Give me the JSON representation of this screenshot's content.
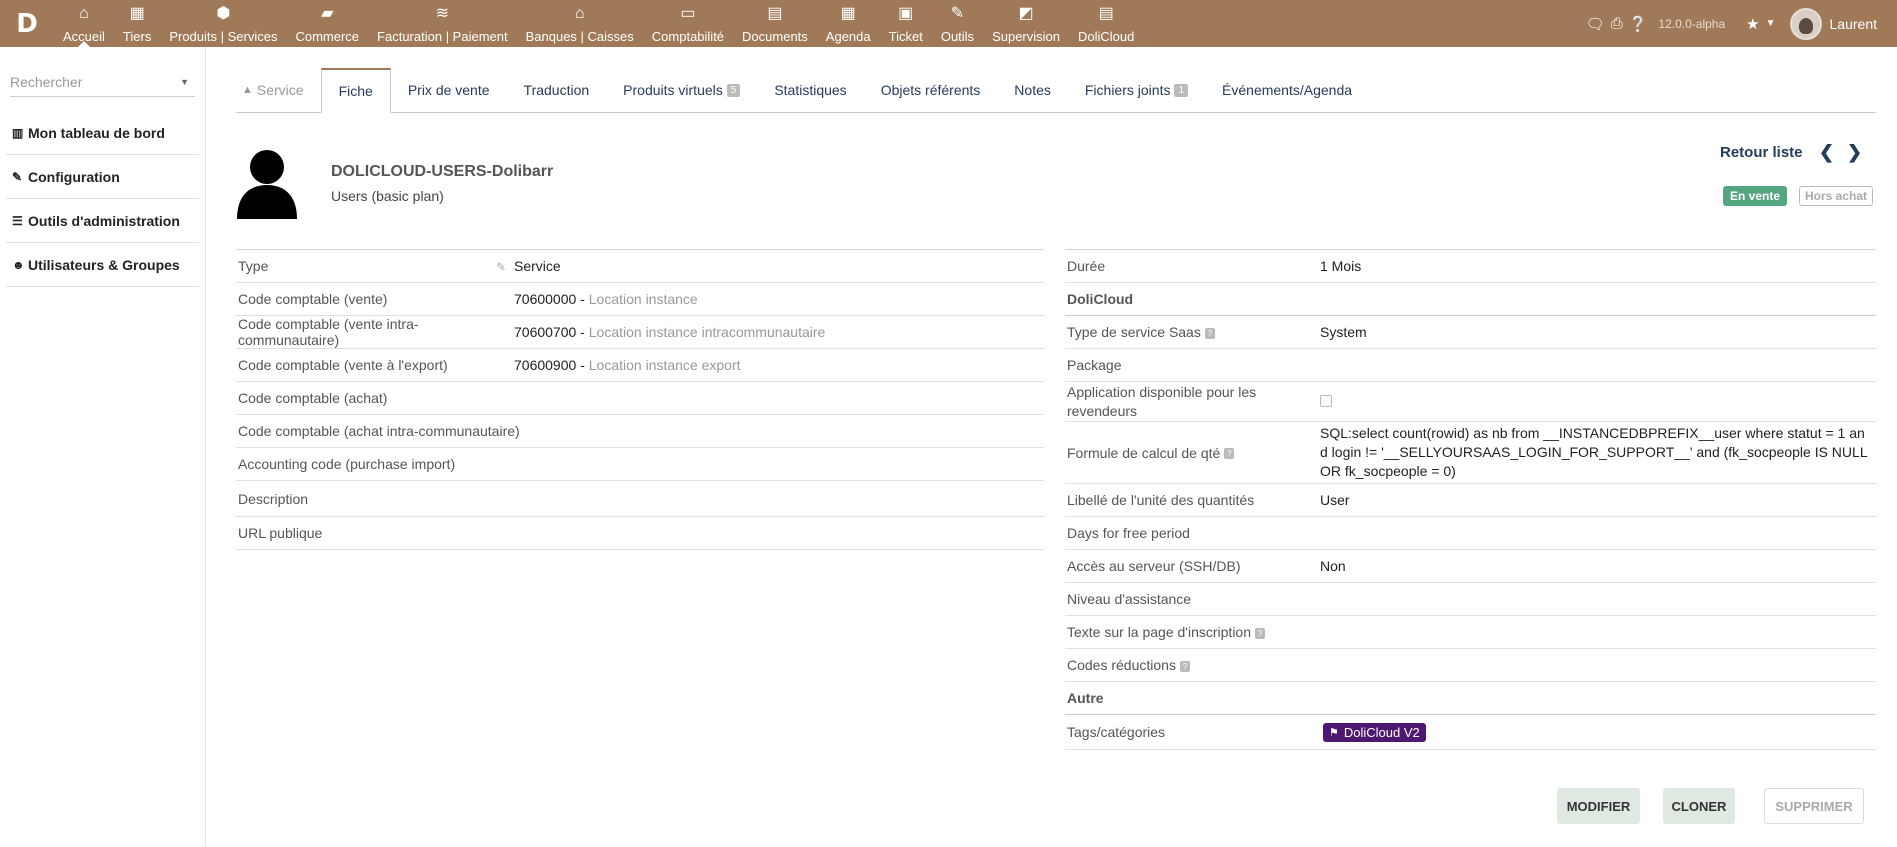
{
  "topmenu": {
    "logo": "D",
    "items": [
      {
        "label": "Accueil",
        "icon": "⌂"
      },
      {
        "label": "Tiers",
        "icon": "▦"
      },
      {
        "label": "Produits | Services",
        "icon": "⬢"
      },
      {
        "label": "Commerce",
        "icon": "▰"
      },
      {
        "label": "Facturation | Paiement",
        "icon": "≋"
      },
      {
        "label": "Banques | Caisses",
        "icon": "⌂"
      },
      {
        "label": "Comptabilité",
        "icon": "▭"
      },
      {
        "label": "Documents",
        "icon": "▤"
      },
      {
        "label": "Agenda",
        "icon": "▦"
      },
      {
        "label": "Ticket",
        "icon": "▣"
      },
      {
        "label": "Outils",
        "icon": "✎"
      },
      {
        "label": "Supervision",
        "icon": "◩"
      },
      {
        "label": "DoliCloud",
        "icon": "▤"
      }
    ],
    "version": "12.0.0-alpha",
    "user": "Laurent"
  },
  "sidebar": {
    "search_placeholder": "Rechercher",
    "items": [
      {
        "label": "Mon tableau de bord",
        "icon": "▥"
      },
      {
        "label": "Configuration",
        "icon": "✎"
      },
      {
        "label": "Outils d'administration",
        "icon": "☰"
      },
      {
        "label": "Utilisateurs & Groupes",
        "icon": "☻"
      }
    ]
  },
  "tabs": {
    "service": "Service",
    "fiche": "Fiche",
    "prix": "Prix de vente",
    "traduction": "Traduction",
    "virtuels": "Produits virtuels",
    "virtuels_count": "5",
    "stats": "Statistiques",
    "objets": "Objets référents",
    "notes": "Notes",
    "fichiers": "Fichiers joints",
    "fichiers_count": "1",
    "events": "Événements/Agenda"
  },
  "product": {
    "ref": "DOLICLOUD-USERS-Dolibarr",
    "label": "Users (basic plan)",
    "back_list": "Retour liste",
    "status_sell": "En vente",
    "status_buy": "Hors achat"
  },
  "left_fields": {
    "type_label": "Type",
    "type_value": "Service",
    "acc_sell_label": "Code comptable (vente)",
    "acc_sell_code": "70600000",
    "acc_sell_desc": "Location instance",
    "acc_intra_label": "Code comptable (vente intra-communautaire)",
    "acc_intra_code": "70600700",
    "acc_intra_desc": "Location instance intracommunautaire",
    "acc_export_label": "Code comptable (vente à l'export)",
    "acc_export_code": "70600900",
    "acc_export_desc": "Location instance export",
    "acc_buy_label": "Code comptable (achat)",
    "acc_buy_intra_label": "Code comptable (achat intra-communautaire)",
    "acc_buy_import_label": "Accounting code (purchase import)",
    "description_label": "Description",
    "url_label": "URL publique",
    "sep": " - "
  },
  "right_fields": {
    "duree_label": "Durée",
    "duree_value": "1 Mois",
    "section_dolicloud": "DoliCloud",
    "saas_type_label": "Type de service Saas",
    "saas_type_value": "System",
    "package_label": "Package",
    "reseller_label": "Application disponible pour les revendeurs",
    "formula_label": "Formule de calcul de qté",
    "formula_value": "SQL:select count(rowid) as nb from __INSTANCEDBPREFIX__user where statut = 1 and login != '__SELLYOURSAAS_LOGIN_FOR_SUPPORT__' and (fk_socpeople IS NULL OR fk_socpeople = 0)",
    "unit_label": "Libellé de l'unité des quantités",
    "unit_value": "User",
    "free_label": "Days for free period",
    "ssh_label": "Accès au serveur (SSH/DB)",
    "ssh_value": "Non",
    "assist_label": "Niveau d'assistance",
    "signup_label": "Texte sur la page d'inscription",
    "discount_label": "Codes réductions",
    "section_other": "Autre",
    "tags_label": "Tags/catégories",
    "tag_value": "DoliCloud V2"
  },
  "buttons": {
    "modify": "MODIFIER",
    "clone": "CLONER",
    "delete": "SUPPRIMER"
  },
  "colors": {
    "topbar": "#a07a58",
    "status_on": "#55a580",
    "tag": "#4c1870"
  }
}
